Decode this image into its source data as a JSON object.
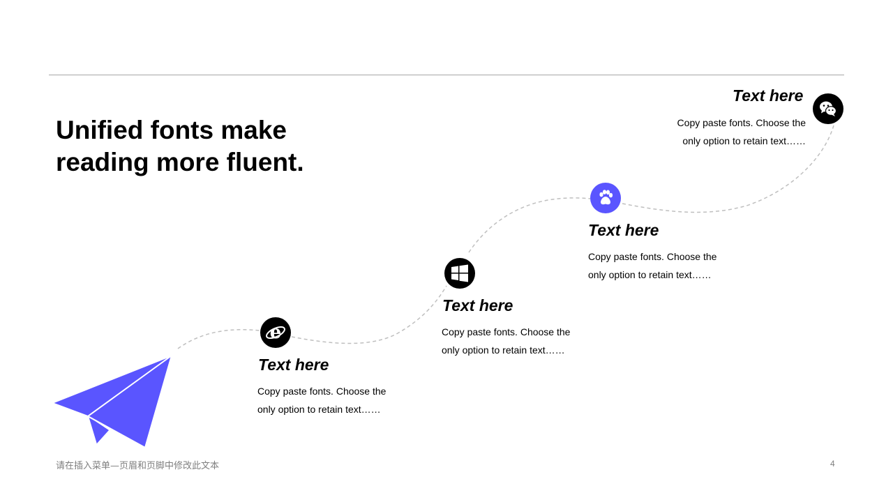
{
  "headline": {
    "line1": "Unified fonts make",
    "line2": "reading more fluent."
  },
  "steps": [
    {
      "title": "Text here",
      "desc_line1": "Copy paste fonts. Choose the",
      "desc_line2": "only option to retain text……",
      "icon": "internet-explorer-icon",
      "icon_color": "#000000"
    },
    {
      "title": "Text here",
      "desc_line1": "Copy paste fonts. Choose the",
      "desc_line2": "only option to retain text……",
      "icon": "windows-icon",
      "icon_color": "#000000"
    },
    {
      "title": "Text here",
      "desc_line1": "Copy paste fonts. Choose the",
      "desc_line2": "only option to retain text……",
      "icon": "paw-icon",
      "icon_color": "#5a55ff"
    },
    {
      "title": "Text here",
      "desc_line1": "Copy paste fonts. Choose the",
      "desc_line2": "only option to retain text……",
      "icon": "wechat-icon",
      "icon_color": "#000000"
    }
  ],
  "footer": {
    "text": "请在插入菜单—页眉和页脚中修改此文本",
    "page_number": "4"
  },
  "colors": {
    "accent": "#5a55ff",
    "rule": "#a6a6a6",
    "path": "#bfbfbf",
    "footer": "#7f7f7f"
  }
}
